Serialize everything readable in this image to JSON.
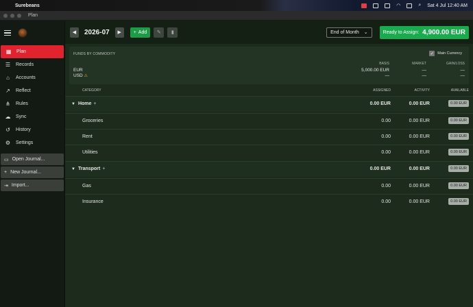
{
  "menubar": {
    "app_name": "Surebeans",
    "clock": "Sat 4 Jul  12:40 AM"
  },
  "window": {
    "title": "Plan"
  },
  "sidebar": {
    "nav": [
      {
        "label": "Plan",
        "icon": "calendar-icon",
        "active": true
      },
      {
        "label": "Records",
        "icon": "list-icon"
      },
      {
        "label": "Accounts",
        "icon": "bank-icon"
      },
      {
        "label": "Reflect",
        "icon": "chart-icon"
      },
      {
        "label": "Rules",
        "icon": "rules-icon"
      },
      {
        "label": "Sync",
        "icon": "sync-icon"
      },
      {
        "label": "History",
        "icon": "history-icon"
      },
      {
        "label": "Settings",
        "icon": "gear-icon"
      }
    ],
    "actions": [
      {
        "label": "Open Journal...",
        "icon": "folder-icon"
      },
      {
        "label": "New Journal...",
        "icon": "plus-icon"
      },
      {
        "label": "Import...",
        "icon": "import-icon"
      }
    ]
  },
  "toolbar": {
    "period": "2026-07",
    "add_label": "Add",
    "view_select": "End of Month",
    "ready_label": "Ready to Assign:",
    "ready_value": "4,900.00 EUR"
  },
  "funds": {
    "heading": "FUNDS BY COMMODITY",
    "main_currency_label": "Main Currency",
    "main_currency_checked": true,
    "columns": {
      "basis": "BASIS",
      "market": "MARKET",
      "gain": "GAIN/LOSS"
    },
    "rows": [
      {
        "commodity": "EUR",
        "basis": "5,000.00 EUR",
        "market": "—",
        "gain": "—",
        "warning": false
      },
      {
        "commodity": "USD",
        "basis": "—",
        "market": "—",
        "gain": "—",
        "warning": true
      }
    ]
  },
  "table": {
    "headers": {
      "category": "CATEGORY",
      "assigned": "ASSIGNED",
      "activity": "ACTIVITY",
      "available": "AVAILABLE"
    },
    "groups": [
      {
        "name": "Home",
        "assigned": "0.00 EUR",
        "activity": "0.00 EUR",
        "available": "0.00 EUR",
        "items": [
          {
            "name": "Groceries",
            "assigned": "0.00",
            "activity": "0.00 EUR",
            "available": "0.00 EUR"
          },
          {
            "name": "Rent",
            "assigned": "0.00",
            "activity": "0.00 EUR",
            "available": "0.00 EUR"
          },
          {
            "name": "Utilities",
            "assigned": "0.00",
            "activity": "0.00 EUR",
            "available": "0.00 EUR"
          }
        ]
      },
      {
        "name": "Transport",
        "assigned": "0.00 EUR",
        "activity": "0.00 EUR",
        "available": "0.00 EUR",
        "items": [
          {
            "name": "Gas",
            "assigned": "0.00",
            "activity": "0.00 EUR",
            "available": "0.00 EUR"
          },
          {
            "name": "Insurance",
            "assigned": "0.00",
            "activity": "0.00 EUR",
            "available": "0.00 EUR"
          }
        ]
      }
    ]
  },
  "colors": {
    "accent_red": "#e0232e",
    "accent_green": "#1aab4e",
    "background": "#1d2b1d"
  }
}
